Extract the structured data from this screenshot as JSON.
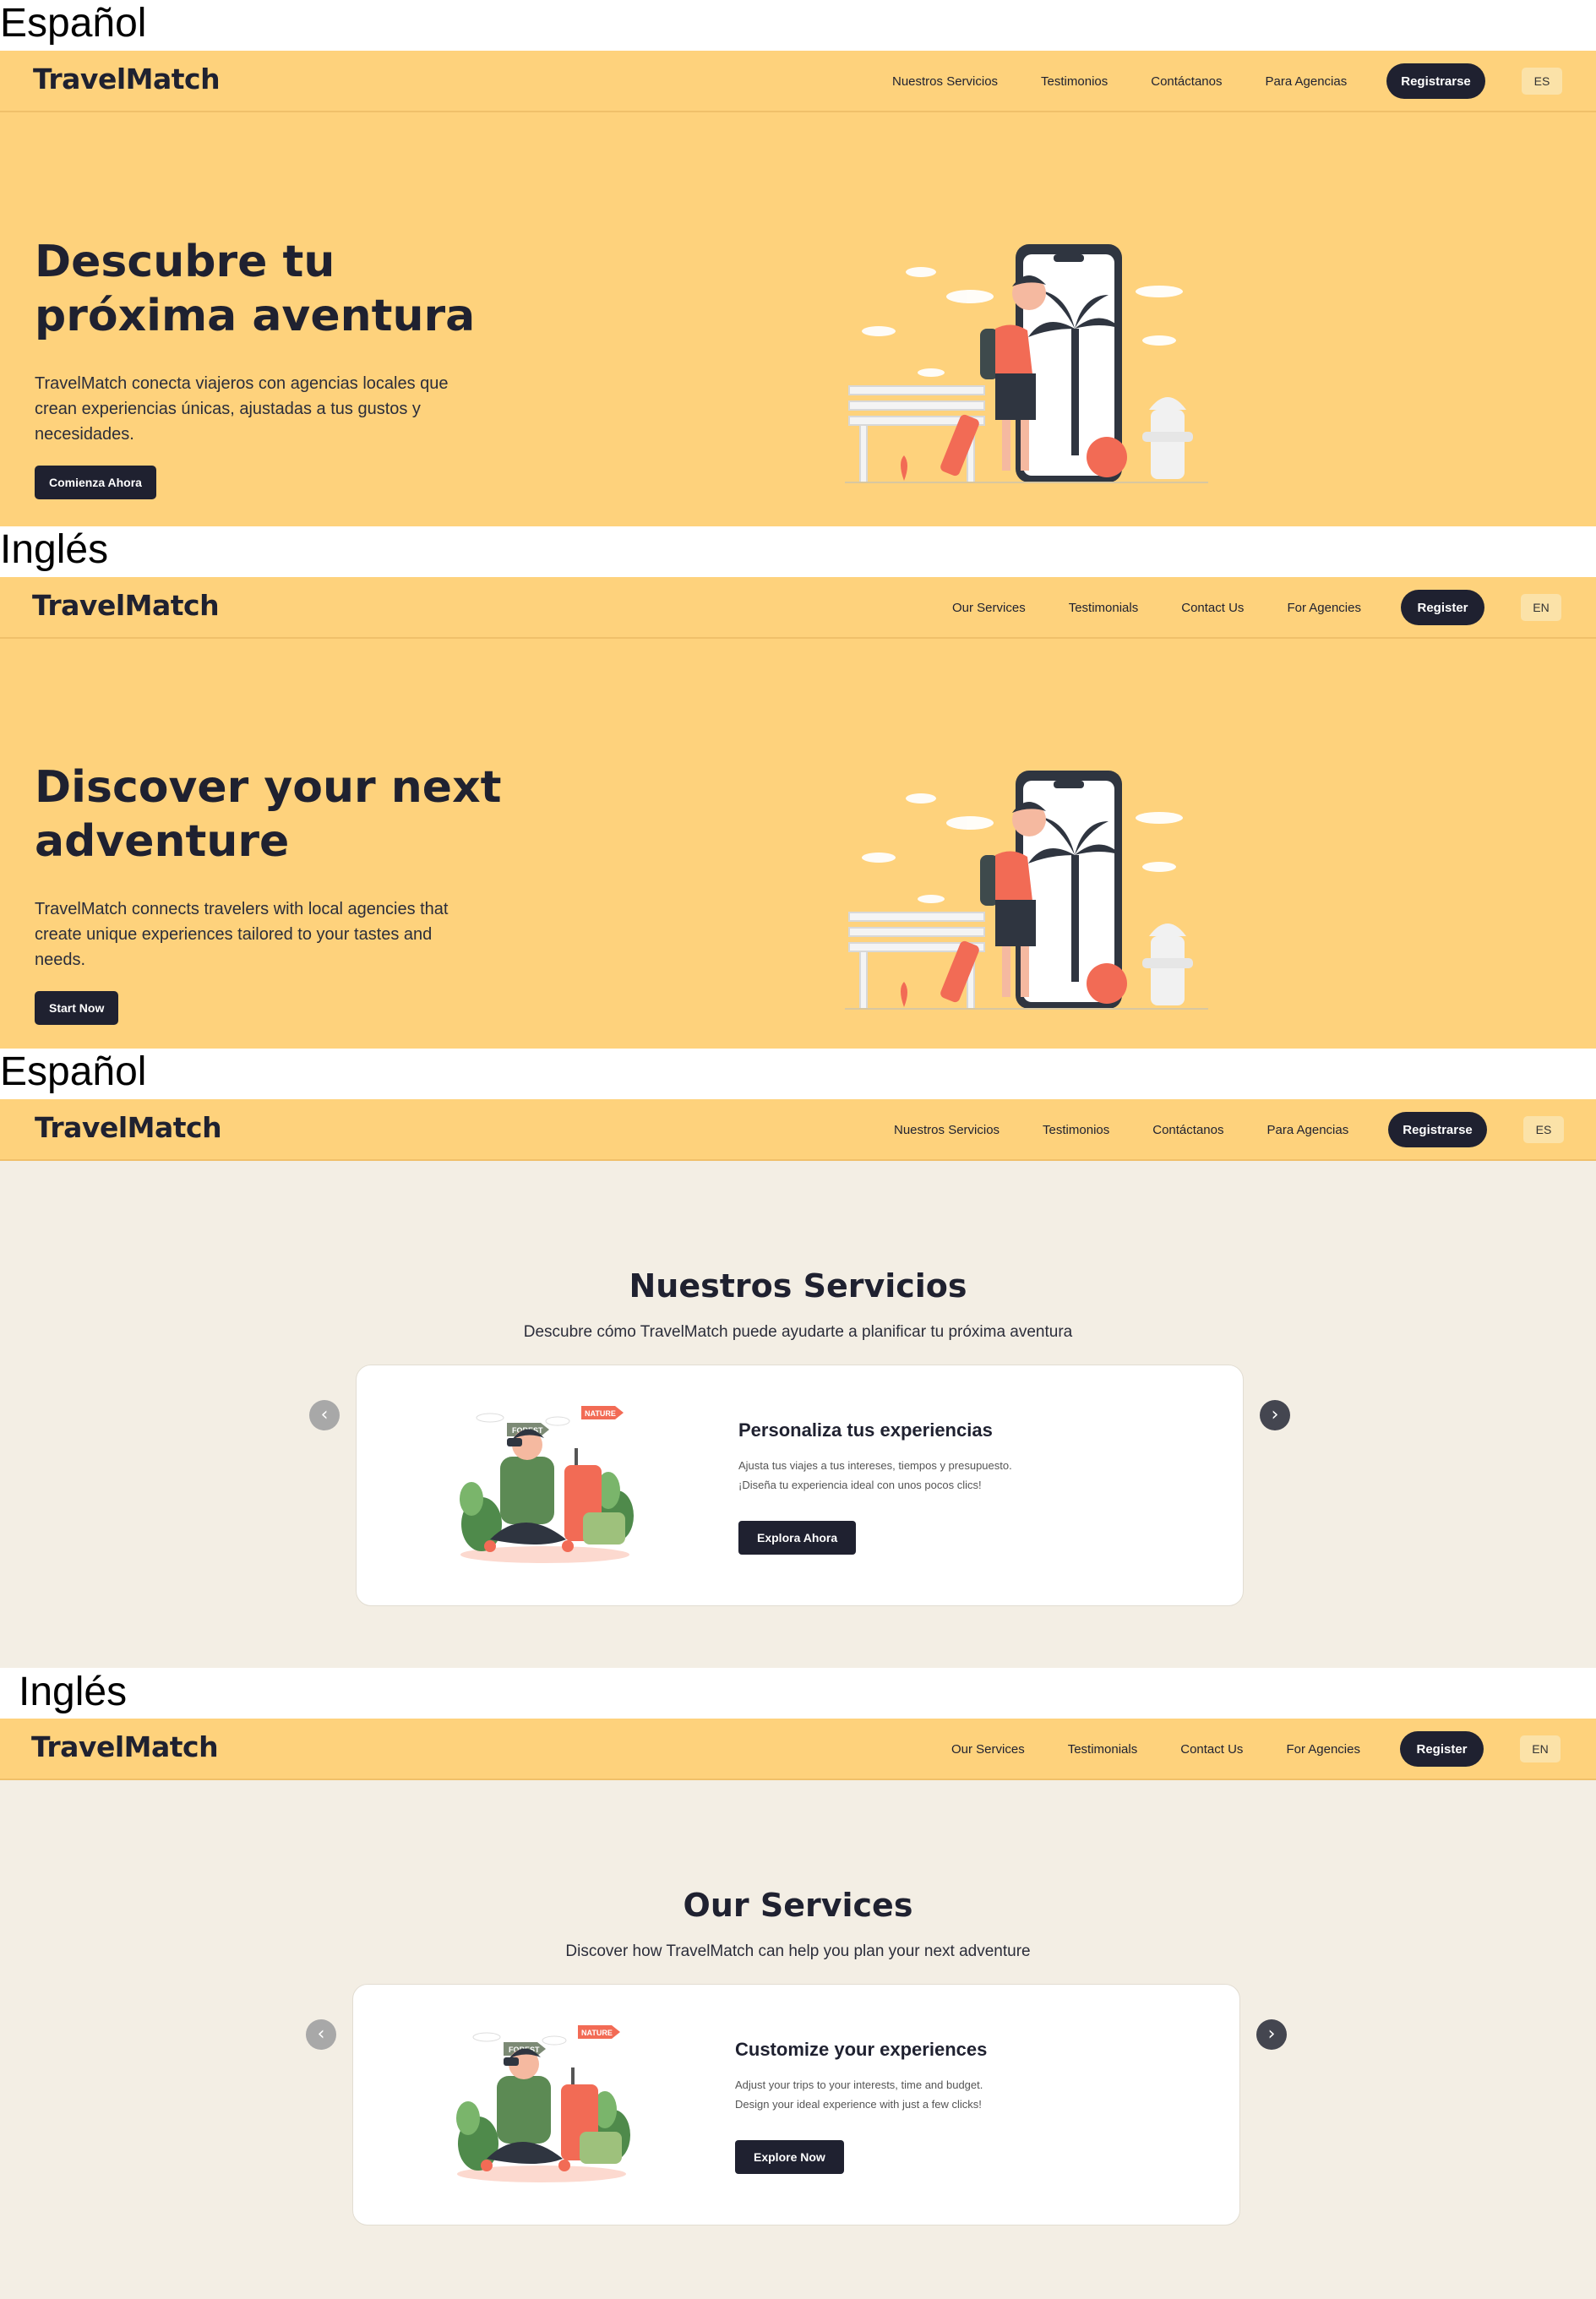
{
  "panels": [
    {
      "caption": "Español",
      "brand": "TravelMatch",
      "nav": [
        "Nuestros Servicios",
        "Testimonios",
        "Contáctanos",
        "Para Agencias"
      ],
      "register": "Registrarse",
      "lang": "ES",
      "hero": {
        "title_line1": "Descubre tu",
        "title_line2": "próxima aventura",
        "text": "TravelMatch conecta viajeros con agencias locales que crean experiencias únicas, ajustadas a tus gustos y necesidades.",
        "cta": "Comienza Ahora"
      }
    },
    {
      "caption": "Inglés",
      "brand": "TravelMatch",
      "nav": [
        "Our Services",
        "Testimonials",
        "Contact Us",
        "For Agencies"
      ],
      "register": "Register",
      "lang": "EN",
      "hero": {
        "title_line1": "Discover your next",
        "title_line2": "adventure",
        "text": "TravelMatch connects travelers with local agencies that create unique experiences tailored to your tastes and needs.",
        "cta": "Start Now"
      }
    },
    {
      "caption": "Español",
      "brand": "TravelMatch",
      "nav": [
        "Nuestros Servicios",
        "Testimonios",
        "Contáctanos",
        "Para Agencias"
      ],
      "register": "Registrarse",
      "lang": "ES",
      "services": {
        "title": "Nuestros Servicios",
        "subtitle": "Descubre cómo TravelMatch puede ayudarte a planificar tu próxima aventura",
        "card_title": "Personaliza tus experiencias",
        "card_line1": "Ajusta tus viajes a tus intereses, tiempos y presupuesto.",
        "card_line2": "¡Diseña tu experiencia ideal con unos pocos clics!",
        "card_cta": "Explora Ahora",
        "sign_forest": "FOREST",
        "sign_nature": "NATURE"
      }
    },
    {
      "caption": "Inglés",
      "brand": "TravelMatch",
      "nav": [
        "Our Services",
        "Testimonials",
        "Contact Us",
        "For Agencies"
      ],
      "register": "Register",
      "lang": "EN",
      "services": {
        "title": "Our Services",
        "subtitle": "Discover how TravelMatch can help you plan your next adventure",
        "card_title": "Customize your experiences",
        "card_line1": "Adjust your trips to your interests, time and budget.",
        "card_line2": "Design your ideal experience with just a few clicks!",
        "card_cta": "Explore Now",
        "sign_forest": "FOREST",
        "sign_nature": "NATURE"
      }
    }
  ],
  "colors": {
    "nav_bg": "#fed27c",
    "dark": "#1f2130",
    "services_bg": "#f3eee4",
    "accent": "#f26b55"
  },
  "icons": [
    "chevron-left-icon",
    "chevron-right-icon"
  ]
}
